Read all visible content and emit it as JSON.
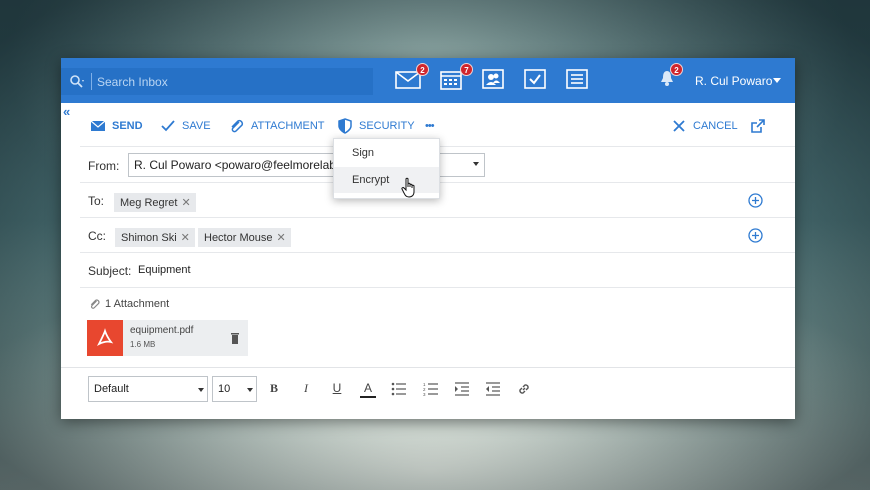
{
  "search": {
    "placeholder": "Search Inbox"
  },
  "top_icons": [
    {
      "name": "mail-icon",
      "badge": "2"
    },
    {
      "name": "calendar-icon",
      "badge": "7"
    },
    {
      "name": "contacts-icon",
      "badge": ""
    },
    {
      "name": "tasks-icon",
      "badge": ""
    },
    {
      "name": "notes-icon",
      "badge": ""
    }
  ],
  "notifications": {
    "badge": "2"
  },
  "user": {
    "name": "R. Cul Powaro"
  },
  "toolbar": {
    "send": "SEND",
    "save": "SAVE",
    "attachment": "ATTACHMENT",
    "security": "SECURITY",
    "more": "•••",
    "cancel": "CANCEL",
    "collapse": "«"
  },
  "security_menu": {
    "items": [
      "Sign",
      "Encrypt"
    ],
    "hovered": "Encrypt"
  },
  "from": {
    "label": "From:",
    "value": "R. Cul Powaro <powaro@feelmorelab"
  },
  "to": {
    "label": "To:",
    "recipients": [
      "Meg Regret"
    ]
  },
  "cc": {
    "label": "Cc:",
    "recipients": [
      "Shimon Ski",
      "Hector Mouse"
    ]
  },
  "subject": {
    "label": "Subject:",
    "value": "Equipment"
  },
  "attachments": {
    "header": "1 Attachment",
    "files": [
      {
        "name": "equipment.pdf",
        "size": "1.6 MB"
      }
    ]
  },
  "format": {
    "font": "Default",
    "size": "10",
    "bold": "B",
    "italic": "I",
    "underline": "U",
    "color": "A"
  },
  "colors": {
    "accent": "#2e7ad1",
    "badge": "#d0262d",
    "pdf": "#e8472f"
  }
}
